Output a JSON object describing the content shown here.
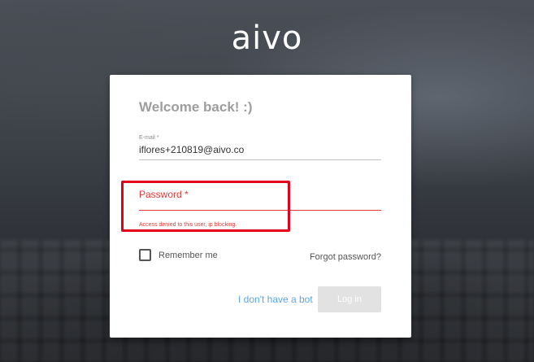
{
  "brand": {
    "logo_text": "aivo"
  },
  "card": {
    "title": "Welcome back! :)",
    "email": {
      "label": "E-mail *",
      "value": "iflores+210819@aivo.co"
    },
    "password": {
      "label": "Password *",
      "value": "",
      "error": "Access denied to this user, ip blocking."
    },
    "remember_label": "Remember me",
    "remember_checked": false,
    "forgot_label": "Forgot password?",
    "no_bot_label": "I don't have a bot",
    "login_label": "Log in"
  },
  "colors": {
    "error": "#e53935",
    "highlight": "#e4001a",
    "link": "#5aa6e8",
    "button_disabled": "#e2e2e2"
  }
}
